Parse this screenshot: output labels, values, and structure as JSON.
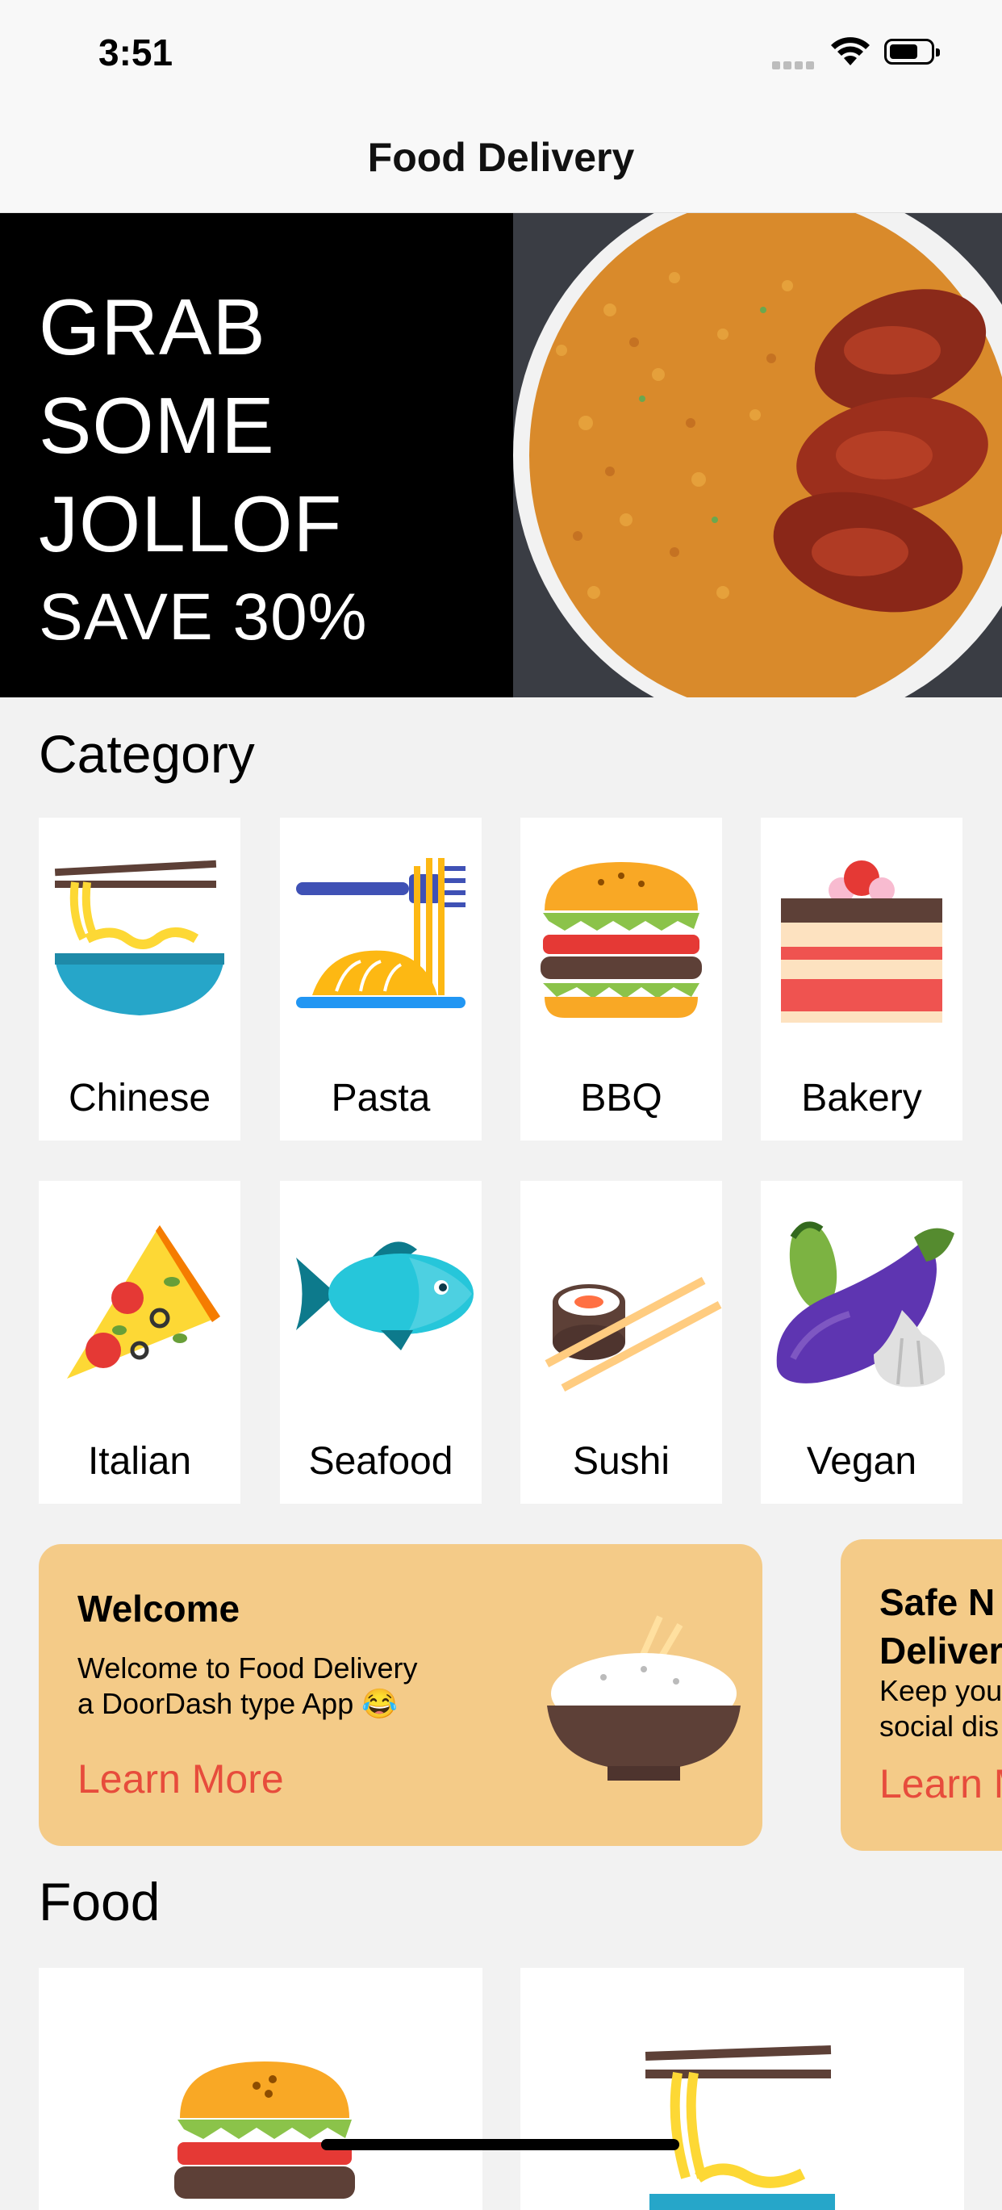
{
  "status_bar": {
    "time": "3:51"
  },
  "nav": {
    "title": "Food Delivery"
  },
  "banner": {
    "line1": "GRAB",
    "line2": "SOME",
    "line3": "JOLLOF",
    "line4": "SAVE 30%"
  },
  "category": {
    "title": "Category",
    "items": [
      {
        "label": "Chinese",
        "icon": "noodles-bowl-icon"
      },
      {
        "label": "Pasta",
        "icon": "pasta-fork-icon"
      },
      {
        "label": "BBQ",
        "icon": "burger-icon"
      },
      {
        "label": "Bakery",
        "icon": "cake-icon"
      },
      {
        "label": "Italian",
        "icon": "pizza-slice-icon"
      },
      {
        "label": "Seafood",
        "icon": "fish-icon"
      },
      {
        "label": "Sushi",
        "icon": "sushi-icon"
      },
      {
        "label": "Vegan",
        "icon": "vegetables-icon"
      }
    ]
  },
  "promos": [
    {
      "title": "Welcome",
      "text": "Welcome to Food Delivery\na DoorDash type App 😂",
      "link": "Learn More"
    },
    {
      "title": "Safe N\nDeliver",
      "text": "Keep you\nsocial dis",
      "link": "Learn M"
    }
  ],
  "food": {
    "title": "Food"
  },
  "colors": {
    "promo_bg": "#f4cb88",
    "link": "#e74c3c",
    "banner_bg": "#000000"
  }
}
